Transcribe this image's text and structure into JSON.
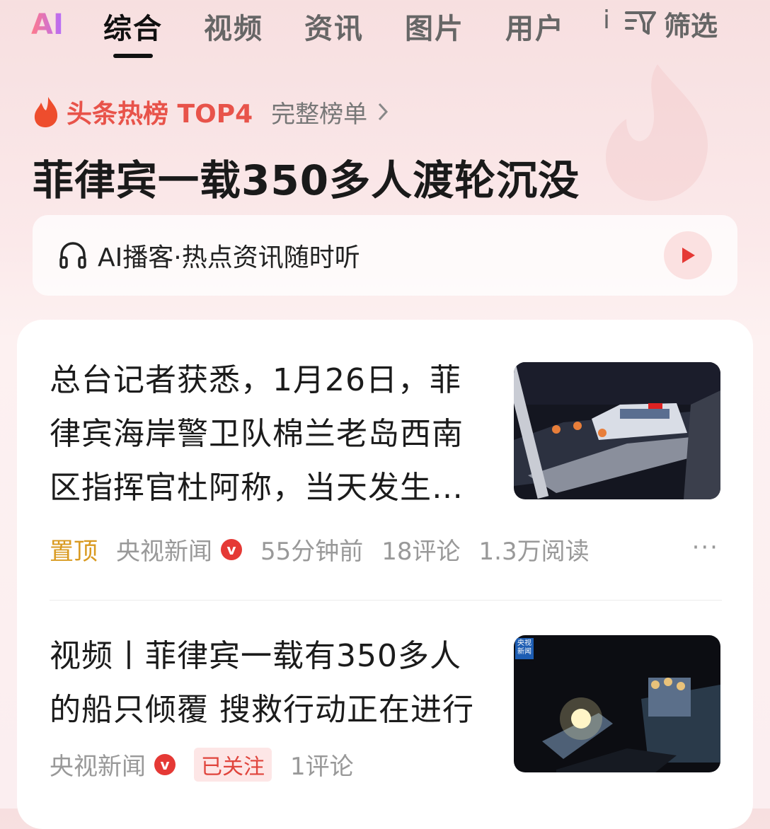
{
  "tabs": {
    "ai": "AI",
    "items": [
      "综合",
      "视频",
      "资讯",
      "图片",
      "用户"
    ],
    "more_glyph": "i",
    "filter_label": "筛选"
  },
  "hot_list": {
    "title": "头条热榜 TOP4",
    "more": "完整榜单"
  },
  "headline": "菲律宾一载350多人渡轮沉没",
  "podcast": {
    "label": "AI播客·热点资讯随时听"
  },
  "articles": [
    {
      "title_lines": [
        "总台记者获悉，1月26日，菲",
        "律宾海岸警卫队棉兰老岛西南",
        "区指挥官杜阿称，当天发生…"
      ],
      "pin": "置顶",
      "source": "央视新闻",
      "badge": "v",
      "time": "55分钟前",
      "comments": "18评论",
      "reads": "1.3万阅读",
      "more": "···"
    },
    {
      "title_lines": [
        "视频丨菲律宾一载有350多人",
        "的船只倾覆 搜救行动正在进行"
      ],
      "source": "央视新闻",
      "badge": "v",
      "follow": "已关注",
      "comments": "1评论",
      "logo": "央视新闻"
    }
  ],
  "colors": {
    "accent": "#e8534a",
    "pin": "#d99a20",
    "verified": "#e53935"
  }
}
